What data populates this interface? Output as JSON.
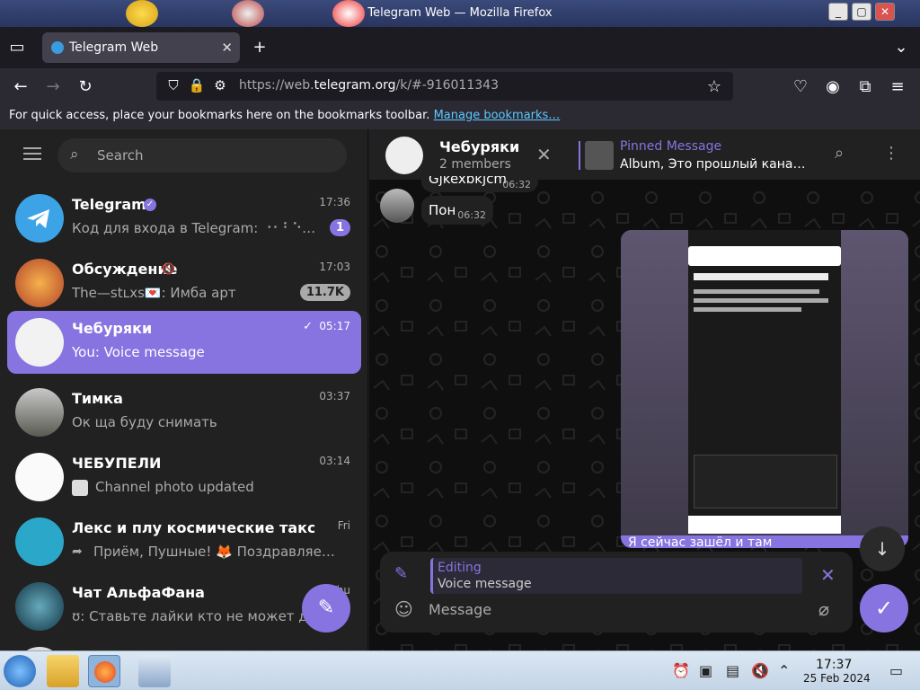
{
  "window": {
    "title": "Telegram Web — Mozilla Firefox"
  },
  "tabs": [
    {
      "label": "Telegram Web"
    }
  ],
  "navbar": {
    "url_prefix": "https://web.",
    "url_domain": "telegram.org",
    "url_suffix": "/k/#-916011343"
  },
  "bookmarks": {
    "message": "For quick access, place your bookmarks here on the bookmarks toolbar.",
    "link": "Manage bookmarks…"
  },
  "sidebar": {
    "search_placeholder": "Search",
    "chats": [
      {
        "name": "Telegram",
        "time": "17:36",
        "preview": "Код для входа в Telegram: ⠐⠂⠃⠑⠂⠑⠂ …",
        "badge": "1",
        "verified": true
      },
      {
        "name": "Обсуждение",
        "time": "17:03",
        "preview": "The—stʟxs💌: Имба арт",
        "badge": "11.7K",
        "muted": true
      },
      {
        "name": "Чебуряки",
        "time": "05:17",
        "preview": "You: Voice message",
        "active": true
      },
      {
        "name": "Тимка",
        "time": "03:37",
        "preview": "Ок ща буду снимать"
      },
      {
        "name": "ЧЕБУПЕЛИ",
        "time": "03:14",
        "preview": "Channel photo updated"
      },
      {
        "name": "Лекс и плу космические таксисты",
        "time": "Fri",
        "preview": "Приём, Пушные! 🦊 Поздравляе…"
      },
      {
        "name": "Чат АльфаФана",
        "time": "Thu",
        "preview": "ʊ: Ставьте лайки кто не может дож"
      }
    ]
  },
  "chat": {
    "title": "Чебуряки",
    "subtitle": "2 members",
    "pinned_title": "Pinned Message",
    "pinned_text": "Album, Это прошлый канал ч…",
    "messages": [
      {
        "text": "Gjkexbkjcm",
        "time": "06:32"
      },
      {
        "text": "Пон",
        "time": "06:32"
      }
    ],
    "photo_caption": "Я сейчас зашёл и там",
    "editing_title": "Editing",
    "editing_text": "Voice message",
    "message_placeholder": "Message"
  },
  "taskbar": {
    "time": "17:37",
    "date": "25 Feb 2024"
  },
  "colors": {
    "accent": "#8774e1",
    "sidebar_bg": "#212121",
    "chat_bg": "#0f0f0f"
  }
}
